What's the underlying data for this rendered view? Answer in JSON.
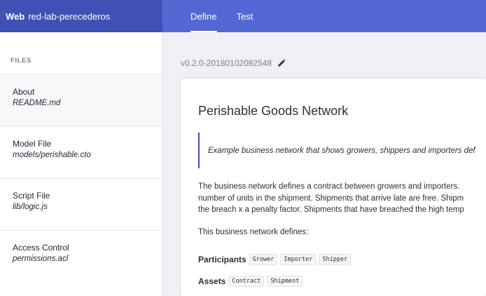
{
  "header": {
    "brand_bold": "Web",
    "brand_name": "red-lab-perecederos",
    "tabs": [
      {
        "label": "Define",
        "active": true
      },
      {
        "label": "Test",
        "active": false
      }
    ],
    "color_brand": "#3f51b5",
    "color_bar": "#5468d4"
  },
  "sidebar": {
    "heading": "FILES",
    "files": [
      {
        "title": "About",
        "path": "README.md"
      },
      {
        "title": "Model File",
        "path": "models/perishable.cto"
      },
      {
        "title": "Script File",
        "path": "lib/logic.js"
      },
      {
        "title": "Access Control",
        "path": "permissions.acl"
      }
    ]
  },
  "main": {
    "version": "v0.2.0-20180102082548",
    "edit_icon": "pencil-icon",
    "title": "Perishable Goods Network",
    "quote": "Example business network that shows growers, shippers and importers def",
    "paragraph_lines": [
      "The business network defines a contract between growers and importers.",
      "number of units in the shipment. Shipments that arrive late are free. Shipm",
      "the breach x a penalty factor. Shipments that have breached the high temp"
    ],
    "defines_text": "This business network defines:",
    "participants_label": "Participants",
    "participants": [
      "Grower",
      "Importer",
      "Shipper"
    ],
    "assets_label": "Assets",
    "assets": [
      "Contract",
      "Shipment"
    ]
  }
}
